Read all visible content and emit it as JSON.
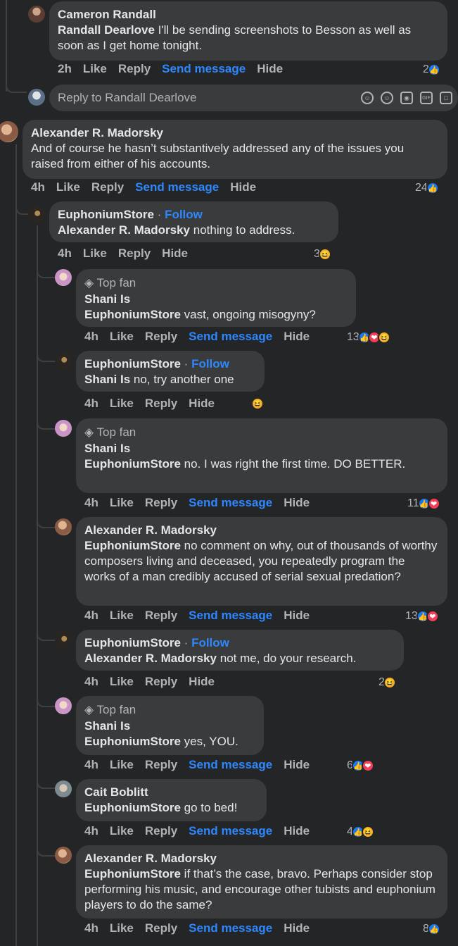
{
  "actions": {
    "like": "Like",
    "reply": "Reply",
    "send": "Send message",
    "hide": "Hide"
  },
  "top_fan": "Top fan",
  "follow": "Follow",
  "reply_box": {
    "placeholder": "Reply to Randall Dearlove"
  },
  "comments": [
    {
      "author": "Cameron Randall",
      "mention": "Randall Dearlove",
      "text": " I'll be sending screenshots to Besson as well as soon as I get home tonight.",
      "time": "2h",
      "count": "2",
      "reactions": [
        "like"
      ]
    },
    {
      "author": "Alexander R. Madorsky",
      "mention": "",
      "text": "And of course he hasn’t substantively addressed any of the issues you raised from either of his accounts.",
      "time": "4h",
      "count": "24",
      "reactions": [
        "like"
      ]
    },
    {
      "author": "EuphoniumStore",
      "mention": "Alexander R. Madorsky",
      "text": " nothing to address.",
      "time": "4h",
      "count": "3",
      "reactions": [
        "haha"
      ]
    },
    {
      "author": "Shani Is",
      "mention": "EuphoniumStore",
      "text": " vast, ongoing misogyny?",
      "time": "4h",
      "count": "13",
      "reactions": [
        "like",
        "love",
        "haha"
      ]
    },
    {
      "author": "EuphoniumStore",
      "mention": "Shani Is",
      "text": " no, try another one",
      "time": "4h",
      "count": "",
      "reactions": [
        "haha"
      ]
    },
    {
      "author": "Shani Is",
      "mention": "EuphoniumStore",
      "text": " no. I was right the first time. DO BETTER.",
      "time": "4h",
      "count": "11",
      "reactions": [
        "like",
        "love"
      ]
    },
    {
      "author": "Alexander R. Madorsky",
      "mention": "EuphoniumStore",
      "text": " no comment on why, out of thousands of worthy composers living and deceased, you repeatedly program the works of a man credibly accused of serial sexual predation?",
      "time": "4h",
      "count": "13",
      "reactions": [
        "like",
        "love"
      ]
    },
    {
      "author": "EuphoniumStore",
      "mention": "Alexander R. Madorsky",
      "text": " not me, do your research.",
      "time": "4h",
      "count": "2",
      "reactions": [
        "haha"
      ]
    },
    {
      "author": "Shani Is",
      "mention": "EuphoniumStore",
      "text": " yes, YOU.",
      "time": "4h",
      "count": "6",
      "reactions": [
        "like",
        "love"
      ]
    },
    {
      "author": "Cait Boblitt",
      "mention": "EuphoniumStore",
      "text": " go to bed!",
      "time": "4h",
      "count": "4",
      "reactions": [
        "like",
        "haha"
      ]
    },
    {
      "author": "Alexander R. Madorsky",
      "mention": "EuphoniumStore",
      "text": " if that’s the case, bravo. Perhaps consider stop performing his music, and encourage other tubists and euphonium players to do the same?",
      "time": "4h",
      "count": "8",
      "reactions": [
        "like"
      ]
    }
  ]
}
